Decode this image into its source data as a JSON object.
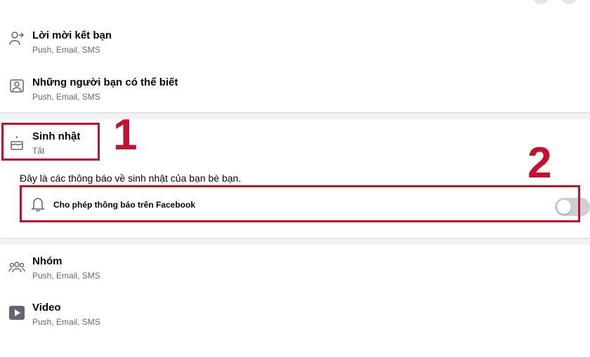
{
  "notification_settings": {
    "items": [
      {
        "title": "Lời mời kết bạn",
        "subtitle": "Push, Email, SMS",
        "icon": "add-friend-icon"
      },
      {
        "title": "Những người bạn có thể biết",
        "subtitle": "Push, Email, SMS",
        "icon": "people-you-may-know-icon"
      },
      {
        "title": "Sinh nhật",
        "subtitle": "Tắt",
        "icon": "birthday-cake-icon",
        "expanded": true
      },
      {
        "title": "Nhóm",
        "subtitle": "Push, Email, SMS",
        "icon": "groups-icon"
      },
      {
        "title": "Video",
        "subtitle": "Push, Email, SMS",
        "icon": "video-icon"
      }
    ],
    "birthday": {
      "description": "Đây là các thông báo về sinh nhật của bạn bè bạn.",
      "allow_label": "Cho phép thông báo trên Facebook",
      "allow_enabled": false
    }
  },
  "annotations": {
    "step1": "1",
    "step2": "2",
    "highlight_color": "#c8102e"
  },
  "colors": {
    "page_background": "#f0f2f5",
    "card_background": "#ffffff",
    "secondary_text": "#65676b",
    "toggle_off": "#ccd0d5"
  }
}
